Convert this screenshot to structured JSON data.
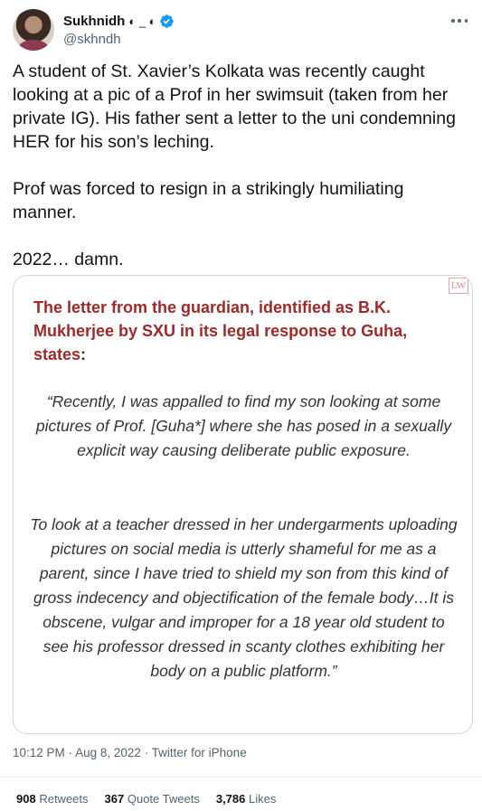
{
  "author": {
    "display_name": "Sukhnidh",
    "name_suffix": "◐ _ ◐",
    "handle": "@skhndh",
    "avatar": "avatar-photo",
    "verified_icon": "verified-badge-icon",
    "verified_color": "#1d9bf0"
  },
  "more_icon": "more-options-icon",
  "tweet": {
    "paragraphs": [
      "A student of St. Xavier’s Kolkata was recently caught looking at a pic of a Prof in her swimsuit (taken from her private IG). His father sent a letter to the uni condemning HER for his son’s leching.",
      "Prof was forced to resign in a strikingly humiliating manner.",
      "2022… damn."
    ]
  },
  "media": {
    "logo_text": "LW",
    "heading": "The letter from the guardian, identified as B.K. Mukherjee by SXU in its legal response to Guha, states",
    "heading_colon": ":",
    "heading_color": "#9b2b2b",
    "quote_1": "“Recently, I was appalled to find my son looking at some pictures of Prof. [Guha*] where she has posed in a sexually explicit way causing deliberate public exposure.",
    "quote_2": "To look at a teacher dressed in her undergarments uploading pictures on social media is utterly shameful for me as a parent, since I have tried to shield my son from this kind of gross indecency and objectification of the female body…It is obscene, vulgar and improper for a 18 year old student to see his professor dressed in scanty clothes exhibiting her body on a public platform.”"
  },
  "meta": {
    "time": "10:12 PM",
    "separator": " · ",
    "date": "Aug 8, 2022",
    "source": "Twitter for iPhone"
  },
  "stats": {
    "retweets_count": "908",
    "retweets_label": "Retweets",
    "quotes_count": "367",
    "quotes_label": "Quote Tweets",
    "likes_count": "3,786",
    "likes_label": "Likes"
  }
}
